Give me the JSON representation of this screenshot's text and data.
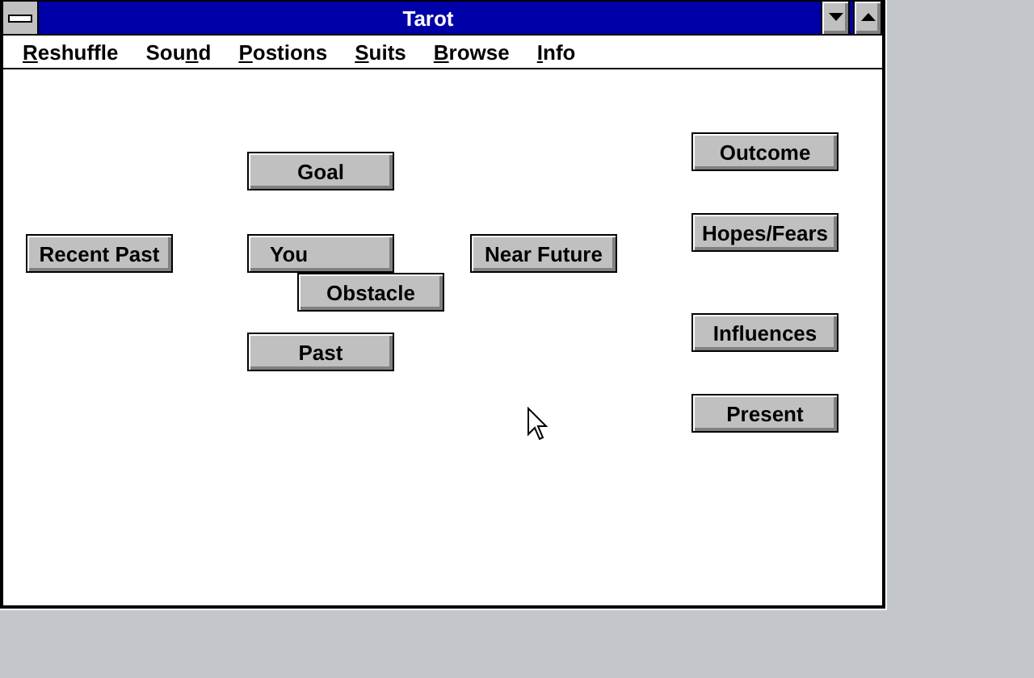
{
  "window": {
    "title": "Tarot"
  },
  "menu": [
    {
      "key": "R",
      "after": "eshuffle"
    },
    {
      "before": "Sou",
      "key": "n",
      "after": "d"
    },
    {
      "key": "P",
      "after": "ostions"
    },
    {
      "key": "S",
      "after": "uits"
    },
    {
      "key": "B",
      "after": "rowse"
    },
    {
      "key": "I",
      "after": "nfo"
    }
  ],
  "positions": [
    {
      "label": "Goal"
    },
    {
      "label": "Recent Past"
    },
    {
      "label": "You"
    },
    {
      "label": "Obstacle"
    },
    {
      "label": "Near Future"
    },
    {
      "label": "Past"
    },
    {
      "label": "Outcome"
    },
    {
      "label": "Hopes/Fears"
    },
    {
      "label": "Influences"
    },
    {
      "label": "Present"
    }
  ]
}
